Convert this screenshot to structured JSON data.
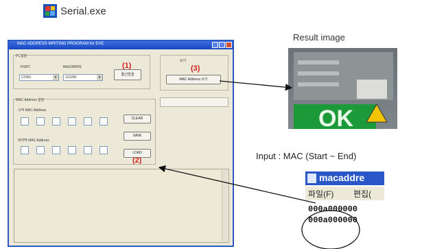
{
  "header": {
    "app_title": "Serial.exe"
  },
  "window": {
    "title": "MAC ADDRESS WRITING PROGRAM for EXE",
    "pc_group_label": "PC설정",
    "port_label": "PORT",
    "baudrate_label": "BAUDRATE",
    "port_value": "COM1",
    "baudrate_value": "115200",
    "connect_button": "통신연결",
    "top_right_label": "쓰기",
    "mac_write_button": "MAC Address 쓰기",
    "mac_group_label": "MAC Address 설정",
    "start_mac_label": "시작 MAC Address",
    "end_mac_label": "마지막 MAC Address",
    "clear_button": "CLEAR",
    "save_button": "SAVE",
    "load_button": "LOAD"
  },
  "annotations": {
    "label_1": "(1)",
    "label_2": "(2)",
    "label_3": "(3)"
  },
  "result": {
    "caption": "Result image",
    "ok_text": "OK"
  },
  "input": {
    "caption": "Input : MAC (Start ~ End)",
    "notepad_title": "macaddre",
    "menu_file": "파일(F)",
    "menu_edit": "편집(",
    "line_1": "000a000000",
    "line_2": "000a000000"
  },
  "colors": {
    "annotation_red": "#d02020",
    "ok_green": "#1c9a3a",
    "titlebar_blue": "#2d59c4"
  }
}
